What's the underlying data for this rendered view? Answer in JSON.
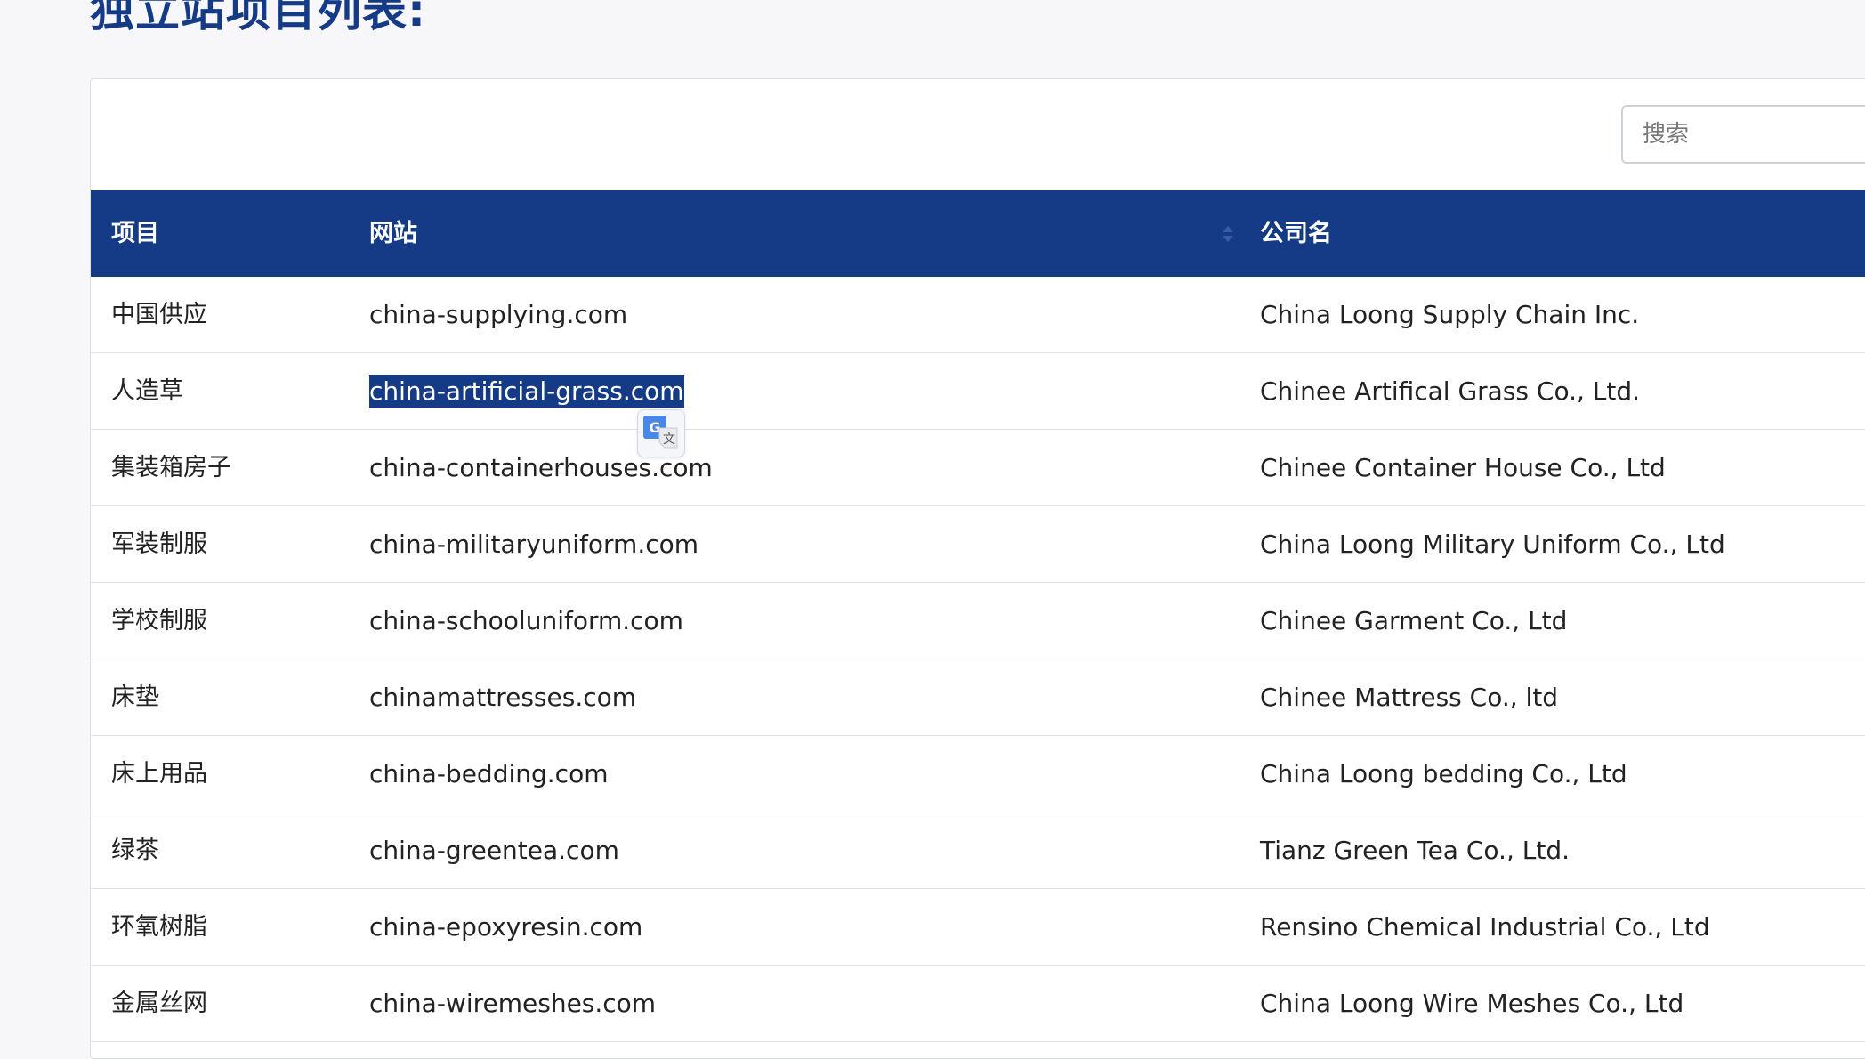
{
  "page": {
    "title": "独立站项目列表:"
  },
  "search": {
    "placeholder": "搜索",
    "value": ""
  },
  "table": {
    "headers": [
      "项目",
      "网站",
      "公司名"
    ],
    "rows": [
      {
        "project": "中国供应",
        "website": "china-supplying.com",
        "company": "China Loong Supply Chain Inc."
      },
      {
        "project": "人造草",
        "website": "china-artificial-grass.com",
        "company": "Chinee Artifical Grass Co., Ltd."
      },
      {
        "project": "集装箱房子",
        "website": "china-containerhouses.com",
        "company": "Chinee Container House Co., Ltd"
      },
      {
        "project": "军装制服",
        "website": "china-militaryuniform.com",
        "company": "China Loong Military Uniform Co., Ltd"
      },
      {
        "project": "学校制服",
        "website": "china-schooluniform.com",
        "company": "Chinee Garment Co., Ltd"
      },
      {
        "project": "床垫",
        "website": "chinamattresses.com",
        "company": "Chinee Mattress Co., ltd"
      },
      {
        "project": "床上用品",
        "website": "china-bedding.com",
        "company": "China Loong bedding Co., Ltd"
      },
      {
        "project": "绿茶",
        "website": "china-greentea.com",
        "company": "Tianz Green Tea Co., Ltd."
      },
      {
        "project": "环氧树脂",
        "website": "china-epoxyresin.com",
        "company": "Rensino Chemical Industrial Co., Ltd"
      },
      {
        "project": "金属丝网",
        "website": "china-wiremeshes.com",
        "company": "China Loong Wire Meshes Co., Ltd"
      }
    ]
  },
  "colors": {
    "header_bg": "#163b86",
    "selection_bg": "#163b86",
    "title_color": "#163b86"
  },
  "icons": {
    "translate": "google-translate-icon",
    "sort": "sort-icon"
  }
}
